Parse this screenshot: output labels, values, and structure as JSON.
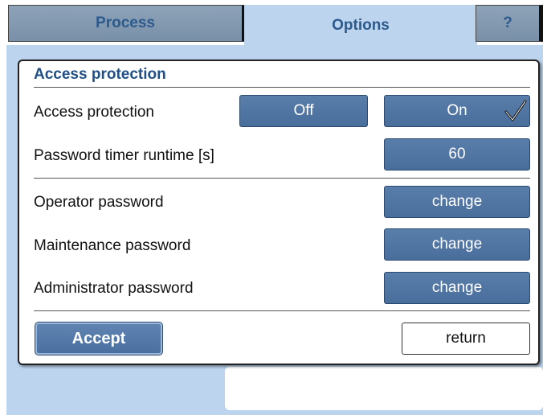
{
  "tabs": [
    {
      "label": "Process"
    },
    {
      "label": "Options"
    },
    {
      "label": "?"
    }
  ],
  "dialog": {
    "title": "Access protection",
    "access_protection": {
      "label": "Access protection",
      "off_label": "Off",
      "on_label": "On",
      "selected": "On",
      "check_icon": "check-icon"
    },
    "password_timer": {
      "label": "Password timer runtime [s]",
      "value": "60"
    },
    "operator_password": {
      "label": "Operator password",
      "button": "change"
    },
    "maintenance_password": {
      "label": "Maintenance password",
      "button": "change"
    },
    "administrator_password": {
      "label": "Administrator password",
      "button": "change"
    },
    "accept_label": "Accept",
    "return_label": "return"
  },
  "colors": {
    "button_blue": "#4f74a2",
    "tab_active": "#bcd4ee",
    "title_blue": "#1f4f86"
  }
}
